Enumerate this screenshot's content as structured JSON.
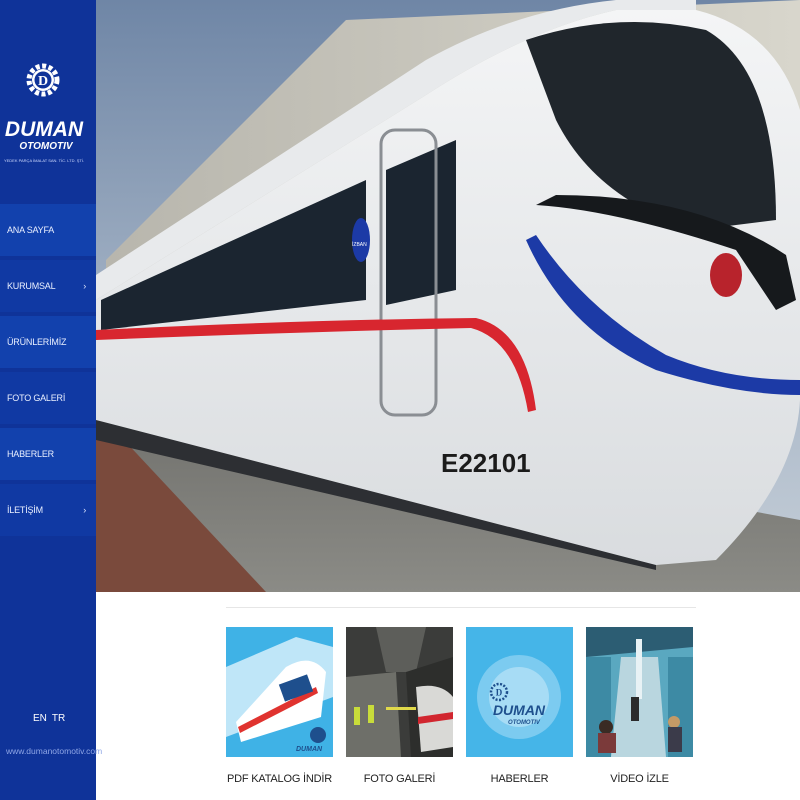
{
  "brand": {
    "name": "DUMAN",
    "sub": "OTOMOTIV",
    "tagline": "YEDEK PARÇA İMALAT SAN. TİC. LTD. ŞTİ.",
    "emblem_letter": "D",
    "website": "www.dumanotomotiv.com",
    "color_primary": "#0f3399"
  },
  "nav": {
    "items": [
      {
        "label": "ANA SAYFA",
        "has_submenu": false
      },
      {
        "label": "KURUMSAL",
        "has_submenu": true
      },
      {
        "label": "ÜRÜNLERİMİZ",
        "has_submenu": false
      },
      {
        "label": "FOTO GALERİ",
        "has_submenu": false
      },
      {
        "label": "HABERLER",
        "has_submenu": false
      },
      {
        "label": "İLETİŞİM",
        "has_submenu": true
      }
    ],
    "chevron": "›"
  },
  "lang": {
    "en": "EN",
    "tr": "TR"
  },
  "hero": {
    "train_number": "E22101",
    "train_logo": "İZBAN"
  },
  "tiles": [
    {
      "label": "PDF KATALOG İNDİR",
      "icon": "catalog-thumbnail"
    },
    {
      "label": "FOTO GALERİ",
      "icon": "photo-gallery-thumbnail"
    },
    {
      "label": "HABERLER",
      "icon": "news-thumbnail"
    },
    {
      "label": "VİDEO İZLE",
      "icon": "video-thumbnail"
    }
  ]
}
